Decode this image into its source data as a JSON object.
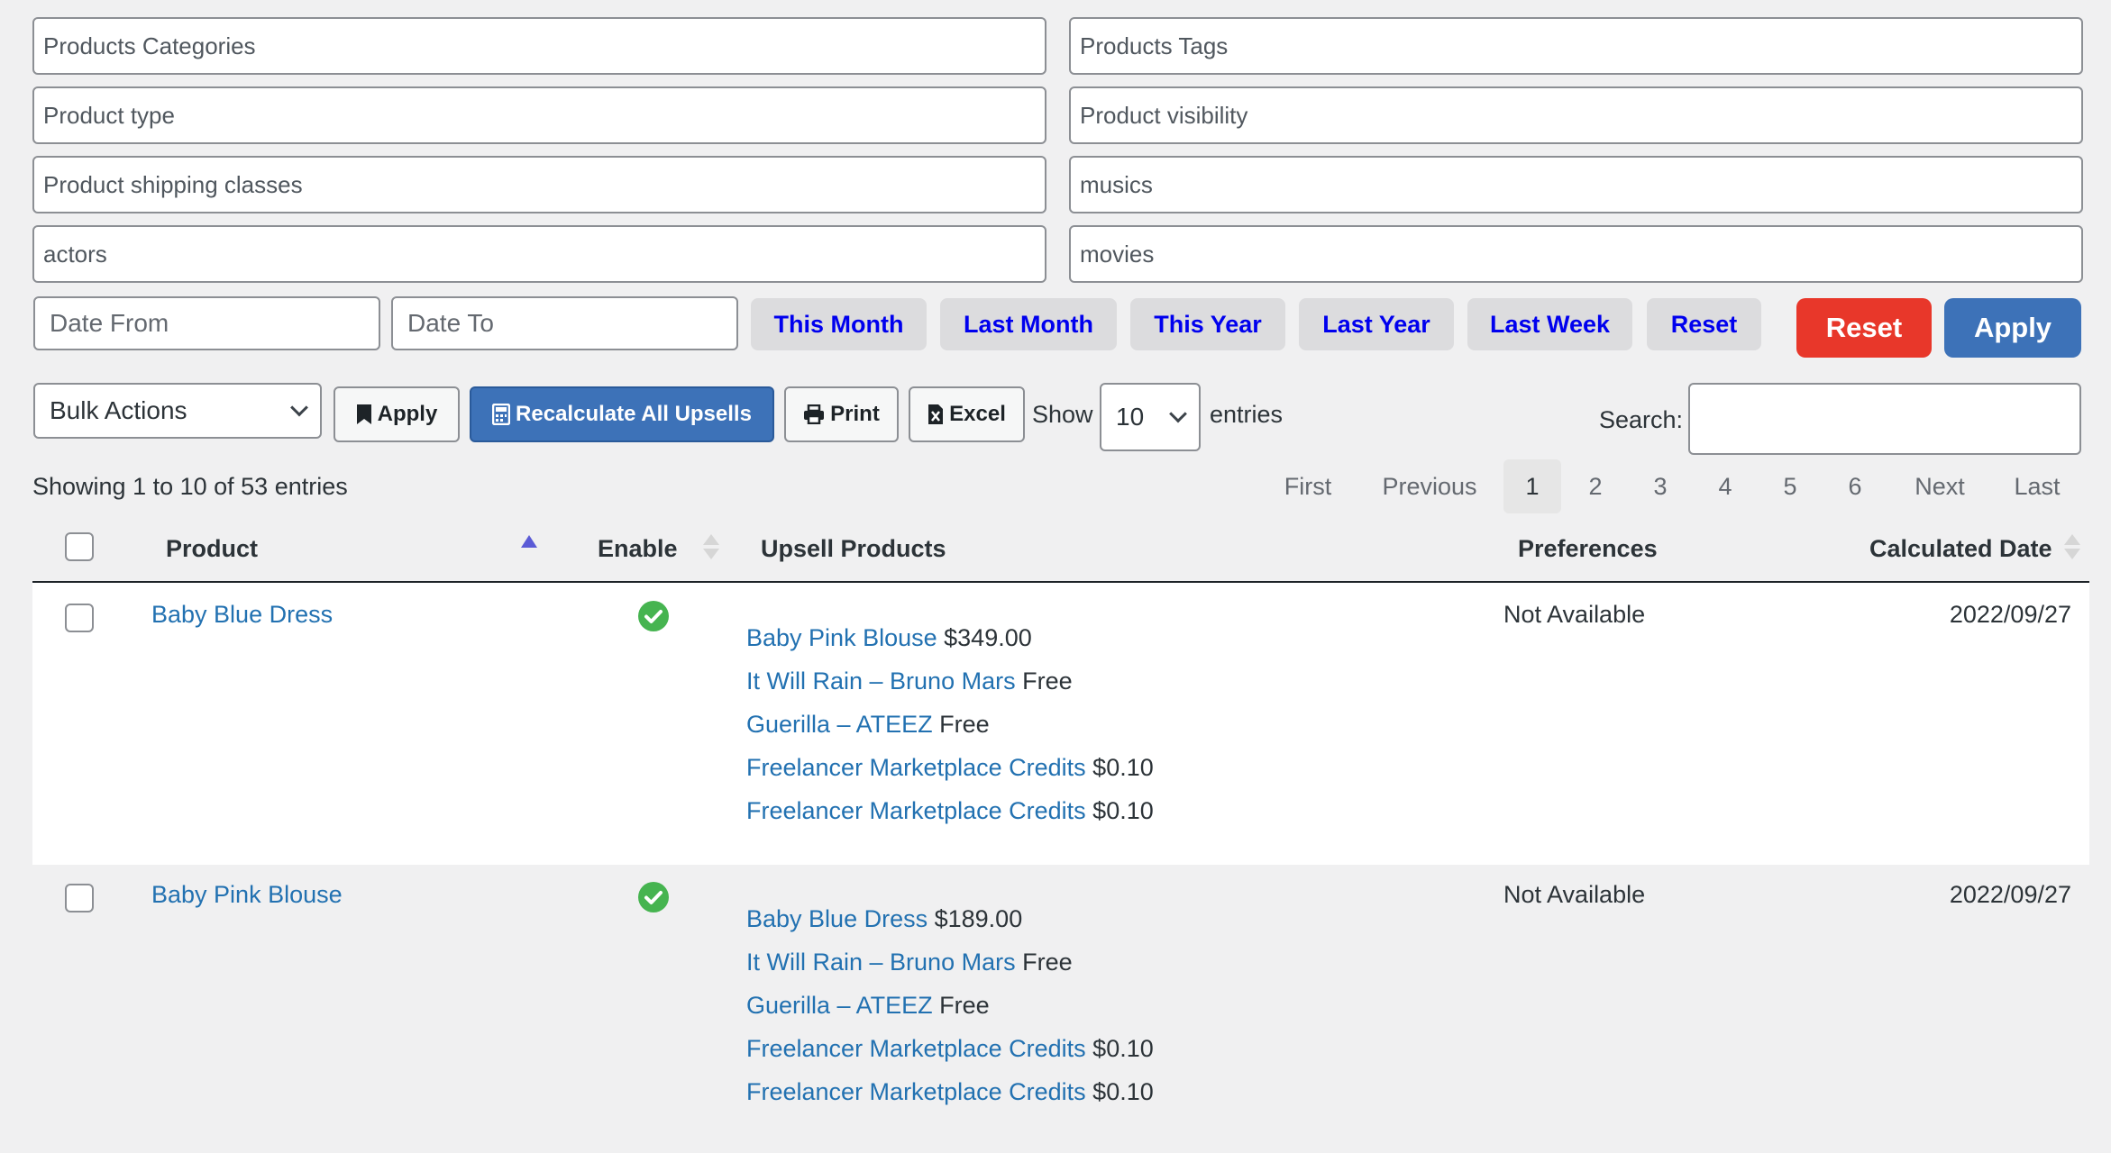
{
  "filters": {
    "products_categories": "Products Categories",
    "products_tags": "Products Tags",
    "product_type": "Product type",
    "product_visibility": "Product visibility",
    "product_shipping_classes": "Product shipping classes",
    "musics": "musics",
    "actors": "actors",
    "movies": "movies"
  },
  "dates": {
    "from_placeholder": "Date From",
    "to_placeholder": "Date To",
    "quick": [
      "This Month",
      "Last Month",
      "This Year",
      "Last Year",
      "Last Week",
      "Reset"
    ],
    "reset_label": "Reset",
    "apply_label": "Apply"
  },
  "toolbar": {
    "bulk_actions": "Bulk Actions",
    "apply_label": "Apply",
    "recalculate_label": "Recalculate All Upsells",
    "print_label": "Print",
    "excel_label": "Excel",
    "show_label": "Show",
    "entries_value": "10",
    "entries_label": "entries",
    "search_label": "Search:"
  },
  "info": "Showing 1 to 10 of 53 entries",
  "pagination": {
    "first": "First",
    "previous": "Previous",
    "pages": [
      "1",
      "2",
      "3",
      "4",
      "5",
      "6"
    ],
    "current": "1",
    "next": "Next",
    "last": "Last"
  },
  "table": {
    "headers": {
      "product": "Product",
      "enable": "Enable",
      "upsell_products": "Upsell Products",
      "preferences": "Preferences",
      "calculated_date": "Calculated Date"
    },
    "rows": [
      {
        "product": "Baby Blue Dress",
        "enabled": true,
        "upsells": [
          {
            "name": "Baby Pink Blouse",
            "price": "$349.00"
          },
          {
            "name": "It Will Rain – Bruno Mars",
            "price": "Free"
          },
          {
            "name": "Guerilla – ATEEZ",
            "price": "Free"
          },
          {
            "name": "Freelancer Marketplace Credits",
            "price": "$0.10"
          },
          {
            "name": "Freelancer Marketplace Credits",
            "price": "$0.10"
          }
        ],
        "preferences": "Not Available",
        "calculated_date": "2022/09/27"
      },
      {
        "product": "Baby Pink Blouse",
        "enabled": true,
        "upsells": [
          {
            "name": "Baby Blue Dress",
            "price": "$189.00"
          },
          {
            "name": "It Will Rain – Bruno Mars",
            "price": "Free"
          },
          {
            "name": "Guerilla – ATEEZ",
            "price": "Free"
          },
          {
            "name": "Freelancer Marketplace Credits",
            "price": "$0.10"
          },
          {
            "name": "Freelancer Marketplace Credits",
            "price": "$0.10"
          }
        ],
        "preferences": "Not Available",
        "calculated_date": "2022/09/27"
      }
    ]
  },
  "colors": {
    "link": "#2271b1",
    "reset_red": "#e8372a",
    "apply_blue": "#3d72b8",
    "quick_text": "#0000ee",
    "check_green": "#46b450"
  }
}
